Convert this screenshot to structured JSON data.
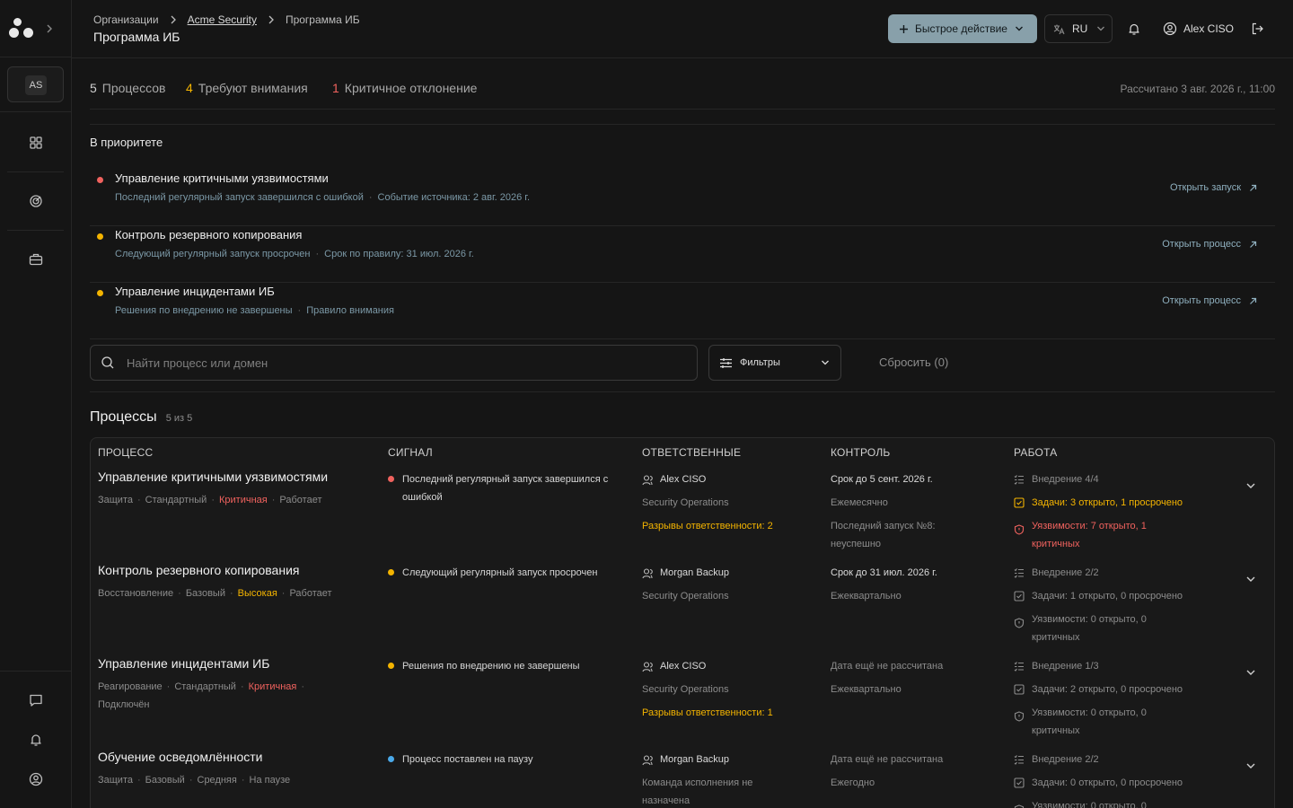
{
  "topbar": {
    "breadcrumbs": [
      "Организации",
      "Acme Security",
      "Программа ИБ"
    ],
    "page_title": "Программа ИБ",
    "quick_action_label": "Быстрое действие",
    "language": "RU",
    "user_name": "Alex CISO"
  },
  "sidebar": {
    "org_badge": "AS",
    "nav_icons": [
      "grid-icon",
      "target-icon",
      "briefcase-icon"
    ],
    "bottom_icons": [
      "chat-icon",
      "bell-icon",
      "user-circle-icon"
    ]
  },
  "summary": {
    "processes_count": "5",
    "processes_label": "Процессов",
    "attention_count": "4",
    "attention_label": "Требуют внимания",
    "critical_count": "1",
    "critical_label": "Критичное отклонение",
    "calculated": "Рассчитано 3 авг. 2026 г., 11:00"
  },
  "colors": {
    "critical": "#f0625e",
    "warning": "#f4b400",
    "info": "#4aa9e9",
    "accent": "#88a0aa",
    "link": "#8fb0bf"
  },
  "priority": {
    "title": "В приоритете",
    "items": [
      {
        "name": "Управление критичными уязвимостями",
        "severity": "critical",
        "meta1": "Последний регулярный запуск завершился с ошибкой",
        "meta2": "Событие источника: 2 авг. 2026 г.",
        "action": "Открыть запуск"
      },
      {
        "name": "Контроль резервного копирования",
        "severity": "warning",
        "meta1": "Следующий регулярный запуск просрочен",
        "meta2": "Срок по правилу: 31 июл. 2026 г.",
        "action": "Открыть процесс"
      },
      {
        "name": "Управление инцидентами ИБ",
        "severity": "warning",
        "meta1": "Решения по внедрению не завершены",
        "meta2": "Правило внимания",
        "action": "Открыть процесс"
      }
    ]
  },
  "search": {
    "placeholder": "Найти процесс или домен",
    "value": ""
  },
  "filters": {
    "label": "Фильтры",
    "reset_label": "Сбросить (0)"
  },
  "processes": {
    "title": "Процессы",
    "count": "5 из 5",
    "columns": [
      "ПРОЦЕСС",
      "СИГНАЛ",
      "ОТВЕТСТВЕННЫЕ",
      "КОНТРОЛЬ",
      "РАБОТА"
    ],
    "rows": [
      {
        "name": "Управление критичными уязвимостями",
        "tags": [
          "Защита",
          "Стандартный",
          "Критичная",
          "Работает"
        ],
        "signal": "Последний регулярный запуск завершился с ошибкой",
        "signal_level": "critical",
        "owner": "Alex CISO",
        "team": "Security Operations",
        "owner_warning": "Разрывы ответственности: 2",
        "control_due": "Срок до 5 сент. 2026 г.",
        "control_freq": "Ежемесячно",
        "control_extra": "Последний запуск №8: неуспешно",
        "work_impl": "Внедрение 4/4",
        "work_tasks": "Задачи: 3 открыто, 1 просрочено",
        "work_vulns": "Уязвимости: 7 открыто, 1 критичных"
      },
      {
        "name": "Контроль резервного копирования",
        "tags": [
          "Восстановление",
          "Базовый",
          "Высокая",
          "Работает"
        ],
        "signal": "Следующий регулярный запуск просрочен",
        "signal_level": "warning",
        "owner": "Morgan Backup",
        "team": "Security Operations",
        "control_due": "Срок до 31 июл. 2026 г.",
        "control_freq": "Ежеквартально",
        "work_impl": "Внедрение 2/2",
        "work_tasks": "Задачи: 1 открыто, 0 просрочено",
        "work_vulns": "Уязвимости: 0 открыто, 0 критичных"
      },
      {
        "name": "Управление инцидентами ИБ",
        "tags": [
          "Реагирование",
          "Стандартный",
          "Критичная",
          "Подключён"
        ],
        "signal": "Решения по внедрению не завершены",
        "signal_level": "warning",
        "owner": "Alex CISO",
        "team": "Security Operations",
        "owner_warning": "Разрывы ответственности: 1",
        "control_due": "Дата ещё не рассчитана",
        "control_freq": "Ежеквартально",
        "work_impl": "Внедрение 1/3",
        "work_tasks": "Задачи: 2 открыто, 0 просрочено",
        "work_vulns": "Уязвимости: 0 открыто, 0 критичных"
      },
      {
        "name": "Обучение осведомлённости",
        "tags": [
          "Защита",
          "Базовый",
          "Средняя",
          "На паузе"
        ],
        "signal": "Процесс поставлен на паузу",
        "signal_level": "info",
        "owner": "Morgan Backup",
        "team": "Команда исполнения не назначена",
        "control_due": "Дата ещё не рассчитана",
        "control_freq": "Ежегодно",
        "work_impl": "Внедрение 2/2",
        "work_tasks": "Задачи: 0 открыто, 0 просрочено",
        "work_vulns": "Уязвимости: 0 открыто, 0"
      }
    ]
  }
}
